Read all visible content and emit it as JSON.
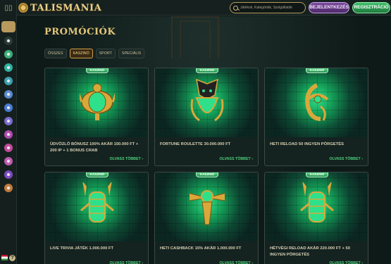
{
  "header": {
    "logo_text": "TALISMANIA",
    "search_placeholder": "Játékok, Kategóriák, Szolgáltatók",
    "login_label": "BEJELENTKEZÉS",
    "register_label": "REGISZTRÁCIÓ"
  },
  "sidebar": {
    "top_icon": "sidebar-toggle-icon",
    "help_label": "?",
    "items": [
      "home-icon",
      "casino-icon",
      "live-icon",
      "jackpot-icon",
      "table-icon",
      "slots-icon",
      "bonus-icon",
      "shop-icon",
      "tournament-icon",
      "vip-icon",
      "scatter-icon",
      "promo-icon",
      "heart-icon"
    ]
  },
  "page": {
    "title": "PROMÓCIÓK"
  },
  "tabs": [
    {
      "label": "ÖSSZES",
      "active": false
    },
    {
      "label": "KASZINÓ",
      "active": true
    },
    {
      "label": "SPORT",
      "active": false
    },
    {
      "label": "SPECIÁLIS",
      "active": false
    }
  ],
  "cards": [
    {
      "badge": "KASZINÓ",
      "title": "ÜDVÖZLŐ BÓNUSZ 100% AKÁR 150.000 FT + 200 IP + 1 BONUS CRAB",
      "more": "OLVASS TÖBBET",
      "emblem": "scarab-icon"
    },
    {
      "badge": "KASZINÓ",
      "title": "FORTUNE ROULETTE 30.000.000 FT",
      "more": "OLVASS TÖBBET",
      "emblem": "anubis-icon"
    },
    {
      "badge": "KASZINÓ",
      "title": "HETI RELOAD 50 INGYEN PÖRGETÉS",
      "more": "OLVASS TÖBBET",
      "emblem": "eye-of-horus-icon"
    },
    {
      "badge": "KASZINÓ",
      "title": "LIVE TRIVIA JÁTÉK 1.000.000 FT",
      "more": "OLVASS TÖBBET",
      "emblem": "twin-jackal-icon"
    },
    {
      "badge": "KASZINÓ",
      "title": "HETI CASHBACK 15% AKÁR 1.000.000 FT",
      "more": "OLVASS TÖBBET",
      "emblem": "winged-sun-icon"
    },
    {
      "badge": "KASZINÓ",
      "title": "HÉTVÉGI RELOAD AKÁR 220.000 FT + 50 INGYEN PÖRGETÉS",
      "more": "OLVASS TÖBBET",
      "emblem": "twin-jackal-icon"
    }
  ],
  "colors": {
    "accent_gold": "#e4c67a",
    "accent_green": "#4fd07a",
    "login_purple": "#7a4a9a",
    "register_green": "#3fbf6a"
  }
}
